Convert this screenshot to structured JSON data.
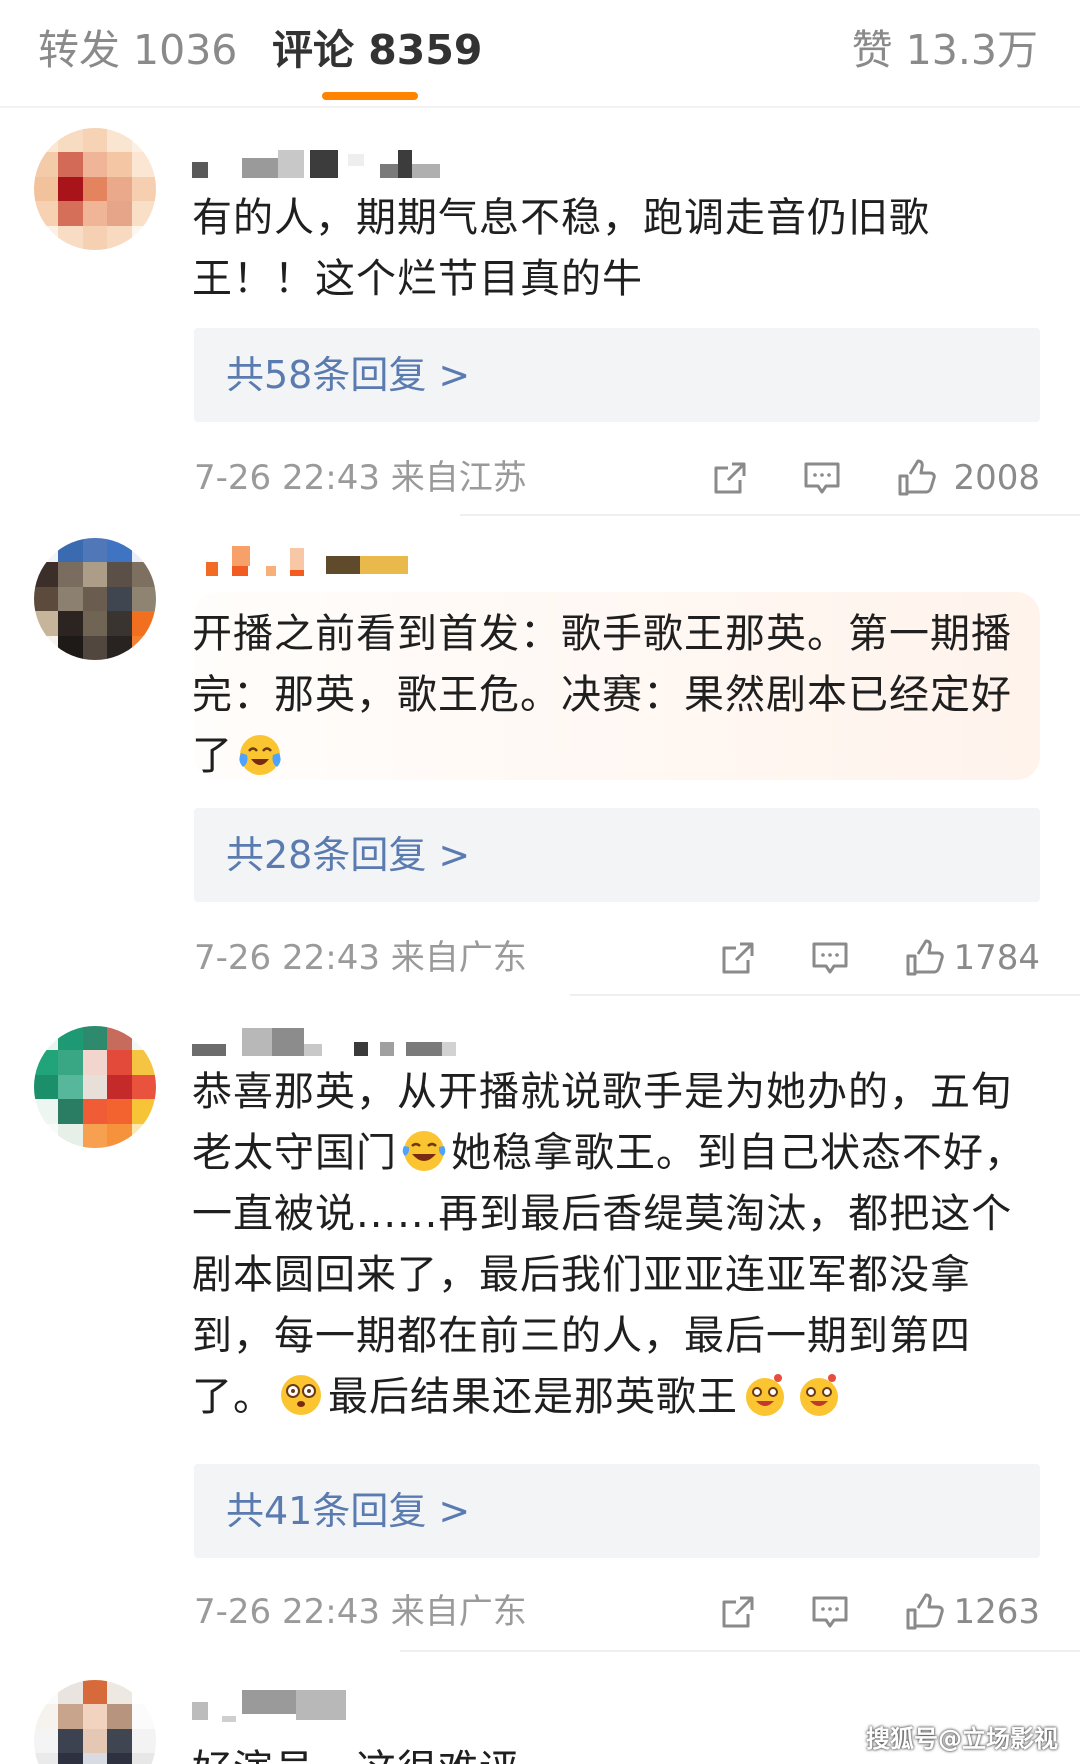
{
  "tabs": {
    "repost": "转发 1036",
    "comment": "评论 8359",
    "like": "赞 13.3万"
  },
  "comments": [
    {
      "text": "有的人，期期气息不稳，跑调走音仍旧歌王！！这个烂节目真的牛",
      "reply_link": "共58条回复 >",
      "time_location": "7-26 22:43 来自江苏",
      "likes": "2008"
    },
    {
      "text_parts": [
        "开播之前看到首发：歌手歌王那英。第一期播完：那英，歌王危。决赛：果然剧本已经定好了"
      ],
      "emojis": [
        "crying-laughing-emoji"
      ],
      "reply_link": "共28条回复 >",
      "time_location": "7-26 22:43 来自广东",
      "likes": "1784"
    },
    {
      "text_parts": [
        "恭喜那英，从开播就说歌手是为她办的，五旬老太守国门",
        "她稳拿歌王。到自己状态不好，一直被说......再到最后香缇莫淘汰，都把这个剧本圆回来了，最后我们亚亚连亚军都没拿到，每一期都在前三的人，最后一期到第四了。",
        "最后结果还是那英歌王"
      ],
      "emojis": [
        "laughing-tears-emoji",
        "dizzy-emoji",
        "surprised-emoji",
        "surprised-emoji"
      ],
      "reply_link": "共41条回复 >",
      "time_location": "7-26 22:43 来自广东",
      "likes": "1263"
    },
    {
      "text_partial": "好演员，这很难评"
    }
  ],
  "watermark": "搜狐号@立场影视",
  "colors": {
    "accent": "#ff8200",
    "reply_link": "#5a7bb0",
    "meta": "#9a9a9a"
  },
  "icons": [
    "share-icon",
    "comment-icon",
    "like-icon"
  ]
}
